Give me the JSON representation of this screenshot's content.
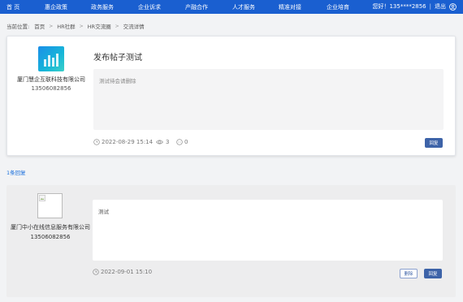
{
  "nav": {
    "items": [
      "首 页",
      "惠企政策",
      "政务服务",
      "企业诉求",
      "产融合作",
      "人才服务",
      "精准对接",
      "企业培育"
    ],
    "greeting": "您好！135****2856",
    "logout": "退出",
    "bg_color": "#1a5fd0"
  },
  "breadcrumb": {
    "label": "当前位置:",
    "items": [
      "首页",
      "HR社群",
      "HR交流圈",
      "交流详情"
    ]
  },
  "post": {
    "company_name": "厦门慧企互联科技有限公司",
    "phone": "13506082856",
    "title": "发布帖子测试",
    "content": "测试待会请删除",
    "datetime": "2022-08-29 15:14",
    "views": "3",
    "comments": "0",
    "reply_label": "回复"
  },
  "reply_count": "1条回复",
  "reply": {
    "company_name": "厦门中小在线信息服务有限公司",
    "phone": "13506082856",
    "content": "测试",
    "datetime": "2022-09-01 15:10",
    "delete_label": "删除",
    "reply_label": "回复"
  },
  "colors": {
    "accent": "#3d63a8",
    "link": "#1a6fdc"
  }
}
